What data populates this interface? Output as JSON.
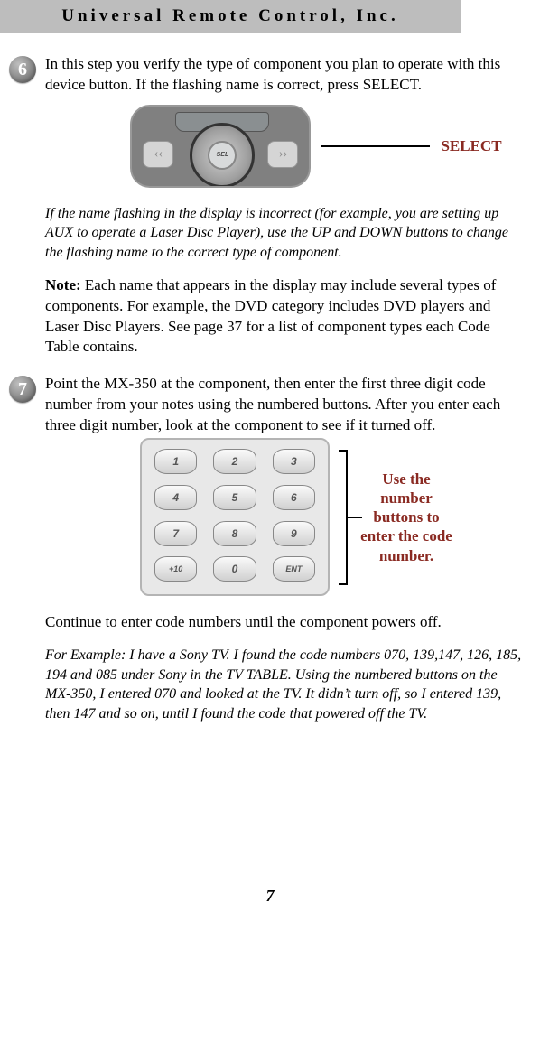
{
  "header": {
    "title": "Universal Remote Control, Inc."
  },
  "step6": {
    "num": "6",
    "intro": "In this step you verify the type of component you plan to operate with this device button. If the flashing name is correct, press SELECT.",
    "sel_button_label": "SEL",
    "callout": "SELECT",
    "italic_note": "If the name flashing in the display is incorrect (for example, you are setting up AUX to operate a Laser Disc Player), use the UP and DOWN buttons to change the flashing name to the correct type of component.",
    "note_label": "Note:",
    "note_text": " Each name that appears in the display may include several types of components. For example, the DVD category includes DVD players and Laser Disc Players.  See page 37 for a list of component types each Code Table contains."
  },
  "step7": {
    "num": "7",
    "intro": "Point the MX-350 at the component, then enter the first three digit code number from your notes using the numbered buttons. After you enter each three digit number, look at the component to see if it turned off.",
    "keypad": {
      "keys": [
        "1",
        "2",
        "3",
        "4",
        "5",
        "6",
        "7",
        "8",
        "9",
        "+10",
        "0",
        "ENT"
      ]
    },
    "callout": "Use the number buttons to enter the code number.",
    "continue": "Continue to enter code numbers until the component powers off.",
    "example": "For Example: I have a Sony TV. I found the code numbers 070, 139,147, 126, 185, 194 and 085 under Sony in the TV TABLE. Using the numbered buttons on the MX-350, I entered  070 and looked at the TV. It didn’t turn off, so I entered 139, then 147 and so on, until I found the code that powered off the TV."
  },
  "page_number": "7"
}
